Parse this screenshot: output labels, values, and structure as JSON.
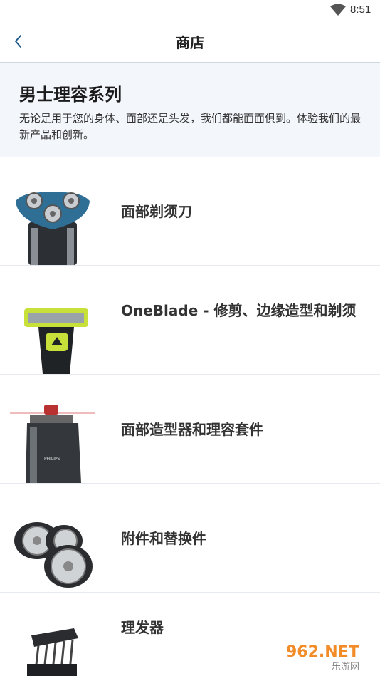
{
  "status_bar": {
    "time": "8:51",
    "wifi_icon": "wifi-icon"
  },
  "app_bar": {
    "title": "商店",
    "back_icon": "chevron-left-icon"
  },
  "intro": {
    "heading": "男士理容系列",
    "description": "无论是用于您的身体、面部还是头发，我们都能面面俱到。体验我们的最新产品和创新。"
  },
  "categories": [
    {
      "label": "面部剃须刀",
      "image": "rotary-shaver-image"
    },
    {
      "label": "OneBlade - 修剪、边缘造型和剃须",
      "image": "oneblade-image"
    },
    {
      "label": "面部造型器和理容套件",
      "image": "beard-styler-image"
    },
    {
      "label": "附件和替换件",
      "image": "shaving-heads-image"
    },
    {
      "label": "理发器",
      "image": "hair-clipper-image"
    }
  ],
  "watermark": {
    "text_top": "962.NET",
    "text_bottom": "乐游网"
  },
  "colors": {
    "accent": "#1e5a8c",
    "intro_bg": "#f3f6fb",
    "divider": "#e6e9ee"
  }
}
